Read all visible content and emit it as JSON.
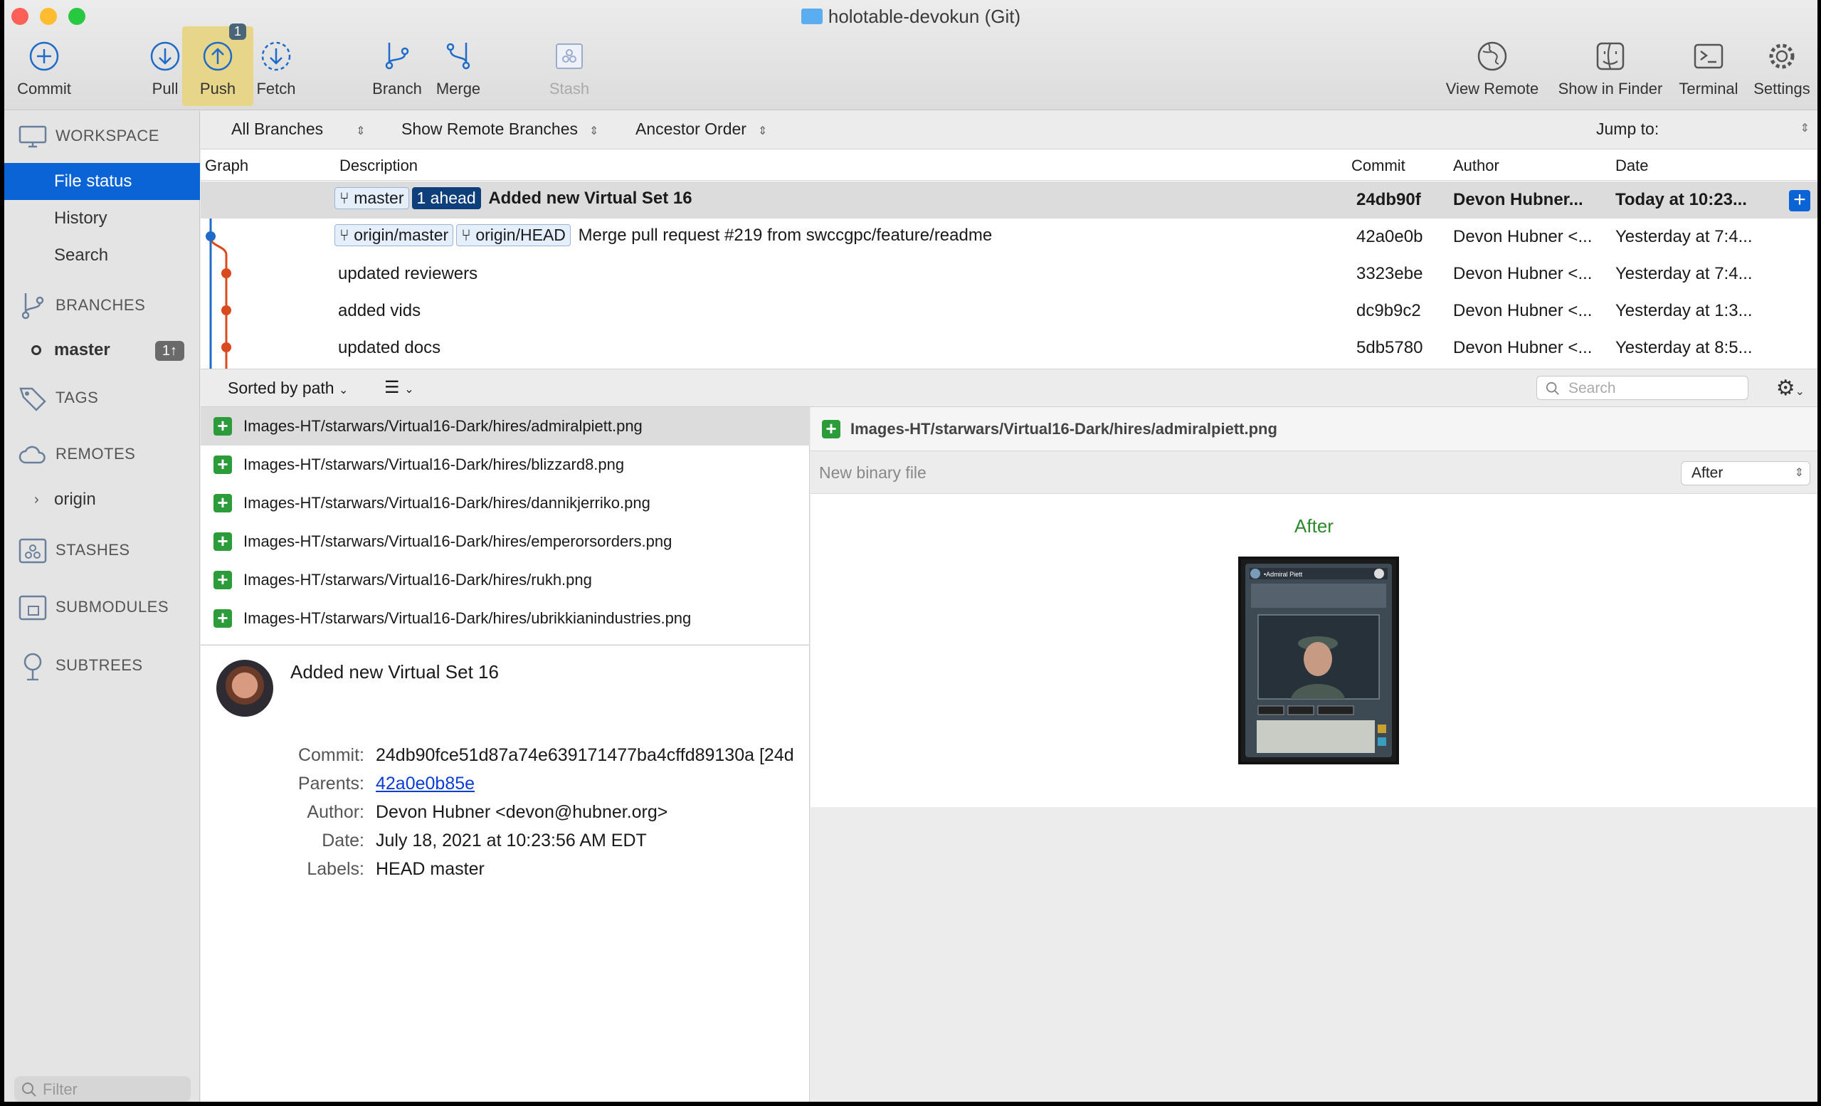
{
  "window": {
    "title": "holotable-devokun (Git)"
  },
  "toolbar": {
    "commit": "Commit",
    "pull": "Pull",
    "push": "Push",
    "push_badge": "1",
    "fetch": "Fetch",
    "branch": "Branch",
    "merge": "Merge",
    "stash": "Stash",
    "view_remote": "View Remote",
    "show_in_finder": "Show in Finder",
    "terminal": "Terminal",
    "settings": "Settings"
  },
  "sidebar": {
    "workspace": "WORKSPACE",
    "workspace_items": [
      "File status",
      "History",
      "Search"
    ],
    "branches": "BRANCHES",
    "branch_name": "master",
    "branch_badge": "1↑",
    "tags": "TAGS",
    "remotes": "REMOTES",
    "remote_name": "origin",
    "stashes": "STASHES",
    "submodules": "SUBMODULES",
    "subtrees": "SUBTREES",
    "filter_placeholder": "Filter"
  },
  "branchbar": {
    "all_branches": "All Branches",
    "show_remote": "Show Remote Branches",
    "order": "Ancestor Order",
    "jump_to": "Jump to:"
  },
  "commits": {
    "headers": {
      "graph": "Graph",
      "description": "Description",
      "commit": "Commit",
      "author": "Author",
      "date": "Date"
    },
    "rows": [
      {
        "tags": [
          "master"
        ],
        "ahead": "1 ahead",
        "desc": "Added new Virtual Set 16",
        "hash": "24db90f",
        "author": "Devon Hubner...",
        "date": "Today at 10:23..."
      },
      {
        "tags": [
          "origin/master",
          "origin/HEAD"
        ],
        "desc": "Merge pull request #219 from swccgpc/feature/readme",
        "hash": "42a0e0b",
        "author": "Devon Hubner <...",
        "date": "Yesterday at 7:4..."
      },
      {
        "tags": [],
        "desc": "updated reviewers",
        "hash": "3323ebe",
        "author": "Devon Hubner <...",
        "date": "Yesterday at 7:4..."
      },
      {
        "tags": [],
        "desc": "added vids",
        "hash": "dc9b9c2",
        "author": "Devon Hubner <...",
        "date": "Yesterday at 1:3..."
      },
      {
        "tags": [],
        "desc": "updated docs",
        "hash": "5db5780",
        "author": "Devon Hubner <...",
        "date": "Yesterday at 8:5..."
      }
    ]
  },
  "filebar": {
    "sort": "Sorted by path",
    "search_placeholder": "Search"
  },
  "files": [
    "Images-HT/starwars/Virtual16-Dark/hires/admiralpiett.png",
    "Images-HT/starwars/Virtual16-Dark/hires/blizzard8.png",
    "Images-HT/starwars/Virtual16-Dark/hires/dannikjerriko.png",
    "Images-HT/starwars/Virtual16-Dark/hires/emperorsorders.png",
    "Images-HT/starwars/Virtual16-Dark/hires/rukh.png",
    "Images-HT/starwars/Virtual16-Dark/hires/ubrikkianindustries.png"
  ],
  "detail": {
    "title": "Added new Virtual Set 16",
    "labels": {
      "commit": "Commit:",
      "parents": "Parents:",
      "author": "Author:",
      "date": "Date:",
      "labels": "Labels:"
    },
    "commit": "24db90fce51d87a74e639171477ba4cffd89130a [24d",
    "parents": "42a0e0b85e",
    "author": "Devon Hubner <devon@hubner.org>",
    "date": "July 18, 2021 at 10:23:56 AM EDT",
    "labels_value": "HEAD master"
  },
  "preview": {
    "file": "Images-HT/starwars/Virtual16-Dark/hires/admiralpiett.png",
    "status": "New binary file",
    "mode": "After",
    "caption": "After",
    "card_name": "•Admiral Piett"
  },
  "colors": {
    "accent": "#0a64d6",
    "added": "#2c9b3a",
    "graph_blue": "#1e6bc9",
    "graph_orange": "#d94a1e"
  }
}
